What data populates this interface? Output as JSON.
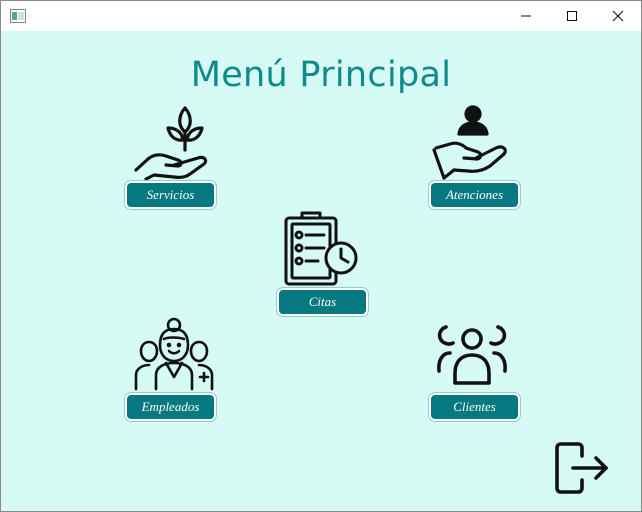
{
  "window": {
    "controls": {
      "minimize": "minimize-icon",
      "maximize": "maximize-icon",
      "close": "close-icon"
    }
  },
  "page": {
    "title": "Menú Principal"
  },
  "menu": {
    "servicios": {
      "label": "Servicios",
      "icon": "hand-plant-icon"
    },
    "atenciones": {
      "label": "Atenciones",
      "icon": "hand-person-icon"
    },
    "citas": {
      "label": "Citas",
      "icon": "clipboard-clock-icon"
    },
    "empleados": {
      "label": "Empleados",
      "icon": "medical-staff-icon"
    },
    "clientes": {
      "label": "Clientes",
      "icon": "people-group-icon"
    }
  },
  "exit": {
    "icon": "logout-icon"
  },
  "colors": {
    "background": "#d6fbf4",
    "accent": "#06787f",
    "title": "#0e8a8f"
  }
}
